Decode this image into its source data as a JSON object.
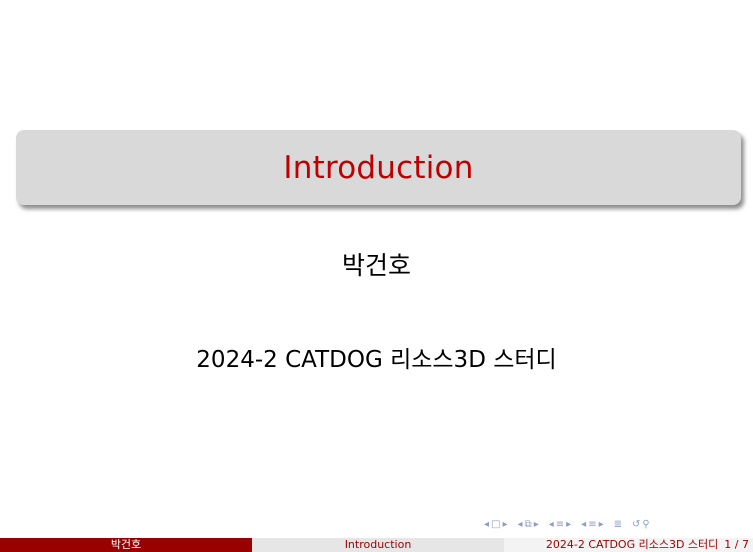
{
  "slide": {
    "title": "Introduction",
    "author": "박건호",
    "event": "2024-2 CATDOG 리소스3D 스터디"
  },
  "footer": {
    "author": "박건호",
    "title": "Introduction",
    "event": "2024-2 CATDOG 리소스3D 스터디",
    "page": "1 / 7"
  },
  "nav": {
    "icons": [
      "frame-prev-icon",
      "frame-icon",
      "frame-next-icon",
      "subsection-prev-icon",
      "subsection-icon",
      "subsection-next-icon",
      "section-prev-icon",
      "section-icon",
      "section-next-icon",
      "toc-prev-icon",
      "toc-icon",
      "toc-next-icon",
      "align-icon",
      "back-icon",
      "search-icon"
    ]
  }
}
